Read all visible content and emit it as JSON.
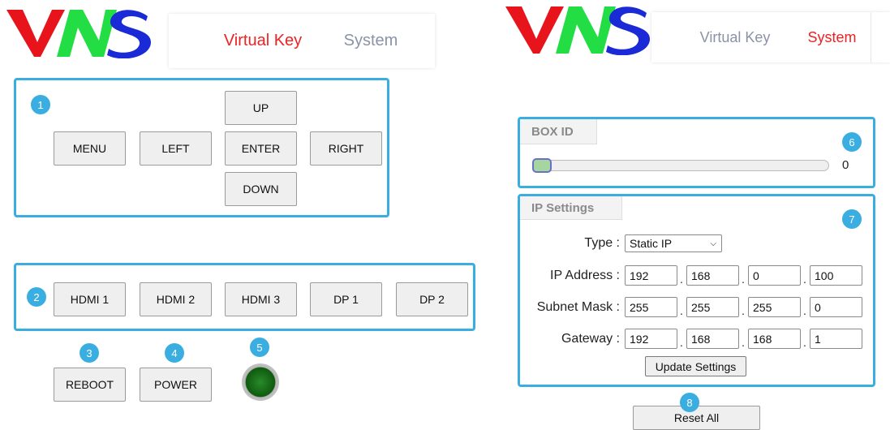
{
  "left": {
    "logo_text": "VNS",
    "tabs": [
      {
        "label": "Virtual Key",
        "state": "active"
      },
      {
        "label": "System",
        "state": "inactive"
      }
    ],
    "callouts": [
      "1",
      "2",
      "3",
      "4",
      "5"
    ],
    "nav_keys": {
      "up": "UP",
      "menu": "MENU",
      "left": "LEFT",
      "enter": "ENTER",
      "right": "RIGHT",
      "down": "DOWN"
    },
    "sources": [
      "HDMI 1",
      "HDMI 2",
      "HDMI 3",
      "DP 1",
      "DP 2"
    ],
    "reboot": "REBOOT",
    "power": "POWER",
    "led_color": "#1a7a1a"
  },
  "right": {
    "logo_text": "VNS",
    "tabs": [
      {
        "label": "Virtual Key",
        "state": "inactive"
      },
      {
        "label": "System",
        "state": "active"
      }
    ],
    "callouts": [
      "6",
      "7",
      "8"
    ],
    "box_id": {
      "legend": "BOX ID",
      "value": "0",
      "slider_fraction": 0
    },
    "ip_settings": {
      "legend": "IP Settings",
      "type_label": "Type :",
      "type_value": "Static IP",
      "ip_label": "IP Address :",
      "ip": [
        "192",
        "168",
        "0",
        "100"
      ],
      "mask_label": "Subnet Mask :",
      "mask": [
        "255",
        "255",
        "255",
        "0"
      ],
      "gateway_label": "Gateway :",
      "gateway": [
        "192",
        "168",
        "168",
        "1"
      ],
      "update_button": "Update Settings"
    },
    "reset_button": "Reset All"
  },
  "colors": {
    "accent_blue": "#3aaee0",
    "active_tab": "#ee2222",
    "inactive_tab": "#8a93a6",
    "logo_v": "#e8141c",
    "logo_n": "#22dd44",
    "logo_s": "#1a2ad6"
  }
}
